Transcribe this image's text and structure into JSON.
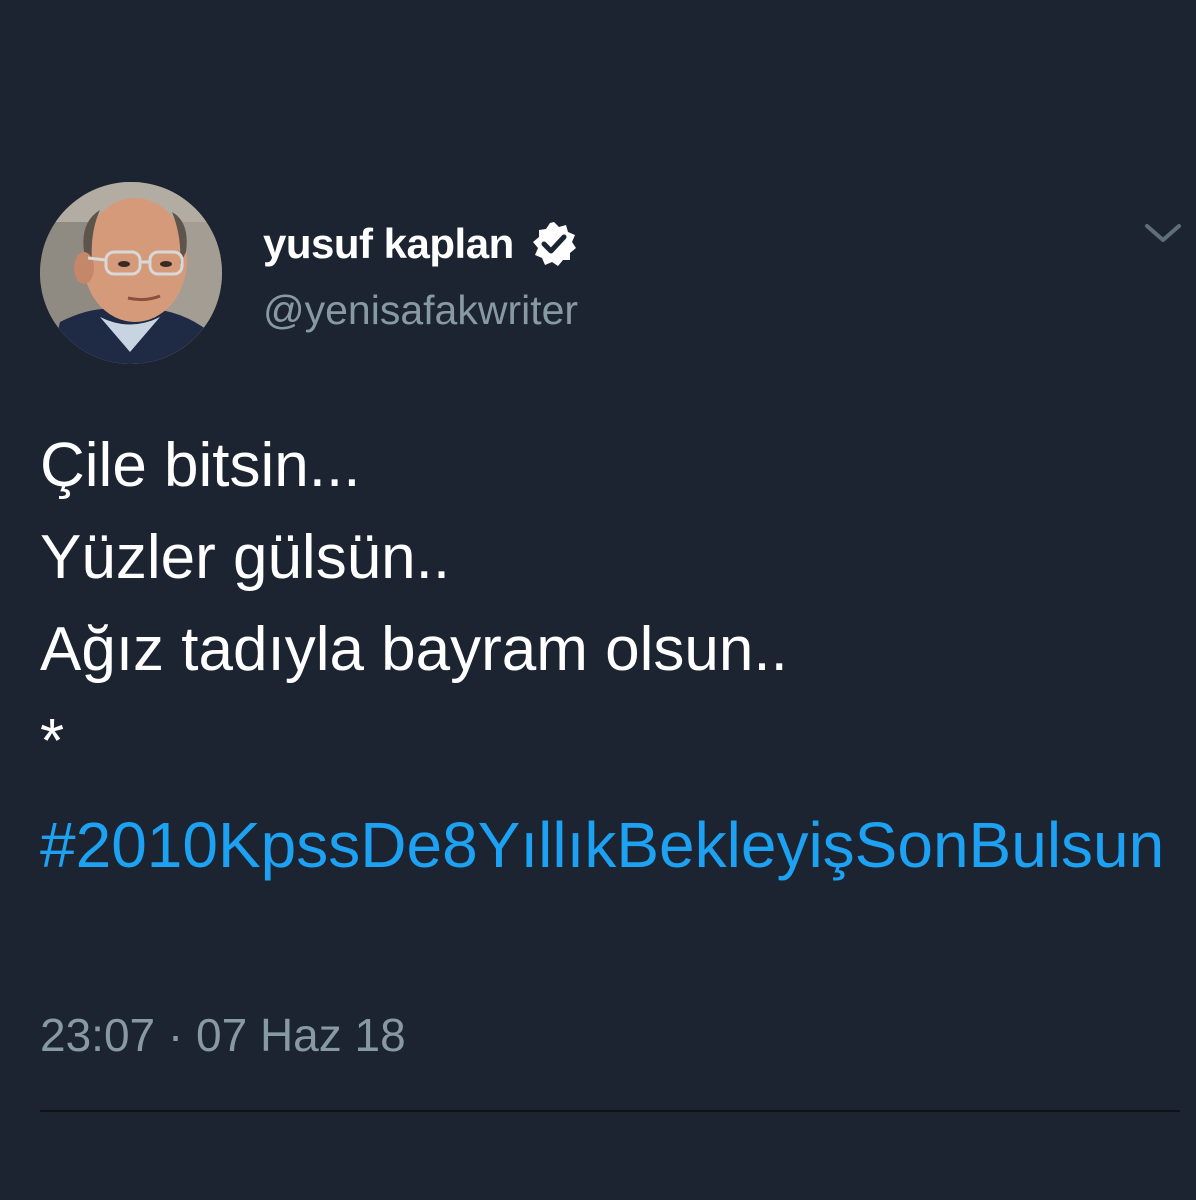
{
  "author": {
    "display_name": "yusuf kaplan",
    "handle": "@yenisafakwriter",
    "verified_icon": "verified-badge-icon"
  },
  "menu_icon": "chevron-down-icon",
  "tweet": {
    "lines": [
      "Çile bitsin...",
      "Yüzler gülsün..",
      "Ağız tadıyla bayram olsun..",
      "*"
    ],
    "hashtag": "#2010KpssDe8YıllıkBekleyişSonBulsun",
    "time": "23:07",
    "separator": "·",
    "date": "07 Haz 18"
  },
  "colors": {
    "background": "#1b2430",
    "text": "#ffffff",
    "secondary_text": "#8899a6",
    "link": "#1da1f2"
  }
}
